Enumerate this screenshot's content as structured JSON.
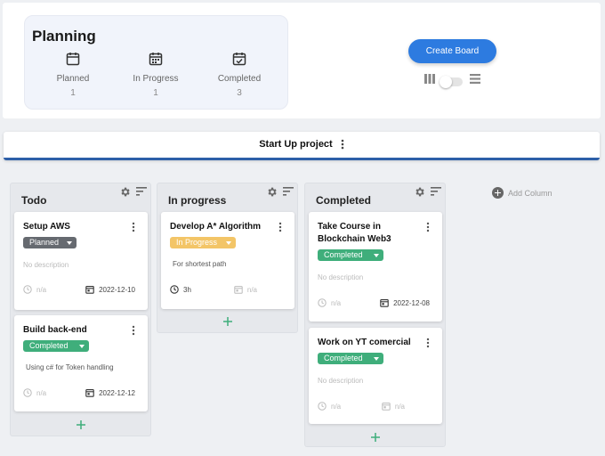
{
  "planning": {
    "title": "Planning",
    "stats": [
      {
        "label": "Planned",
        "count": "1",
        "icon": "calendar-icon"
      },
      {
        "label": "In Progress",
        "count": "1",
        "icon": "calendar-dots-icon"
      },
      {
        "label": "Completed",
        "count": "3",
        "icon": "calendar-check-icon"
      }
    ]
  },
  "toolbar": {
    "create_board_label": "Create Board",
    "view_icons": [
      "columns-view-icon",
      "list-view-icon"
    ]
  },
  "project": {
    "title": "Start Up project"
  },
  "colors": {
    "accent": "#2d7be0",
    "project_underline": "#2d5fa8",
    "planned": "#666a70",
    "in_progress": "#f3c567",
    "completed": "#3fae7b"
  },
  "columns": [
    {
      "title": "Todo",
      "cards": [
        {
          "title": "Setup AWS",
          "status": "Planned",
          "description": "No description",
          "time": "n/a",
          "date": "2022-12-10"
        },
        {
          "title": "Build back-end",
          "status": "Completed",
          "description": "Using c# for Token handling",
          "time": "n/a",
          "date": "2022-12-12"
        }
      ]
    },
    {
      "title": "In progress",
      "cards": [
        {
          "title": "Develop A* Algorithm",
          "status": "In Progress",
          "description": "For shortest path",
          "time": "3h",
          "date": "n/a"
        }
      ]
    },
    {
      "title": "Completed",
      "cards": [
        {
          "title": "Take Course in Blockchain Web3",
          "status": "Completed",
          "description": "No description",
          "time": "n/a",
          "date": "2022-12-08"
        },
        {
          "title": "Work on YT comercial",
          "status": "Completed",
          "description": "No description",
          "time": "n/a",
          "date": "n/a"
        }
      ]
    }
  ],
  "add_column_label": "Add Column"
}
